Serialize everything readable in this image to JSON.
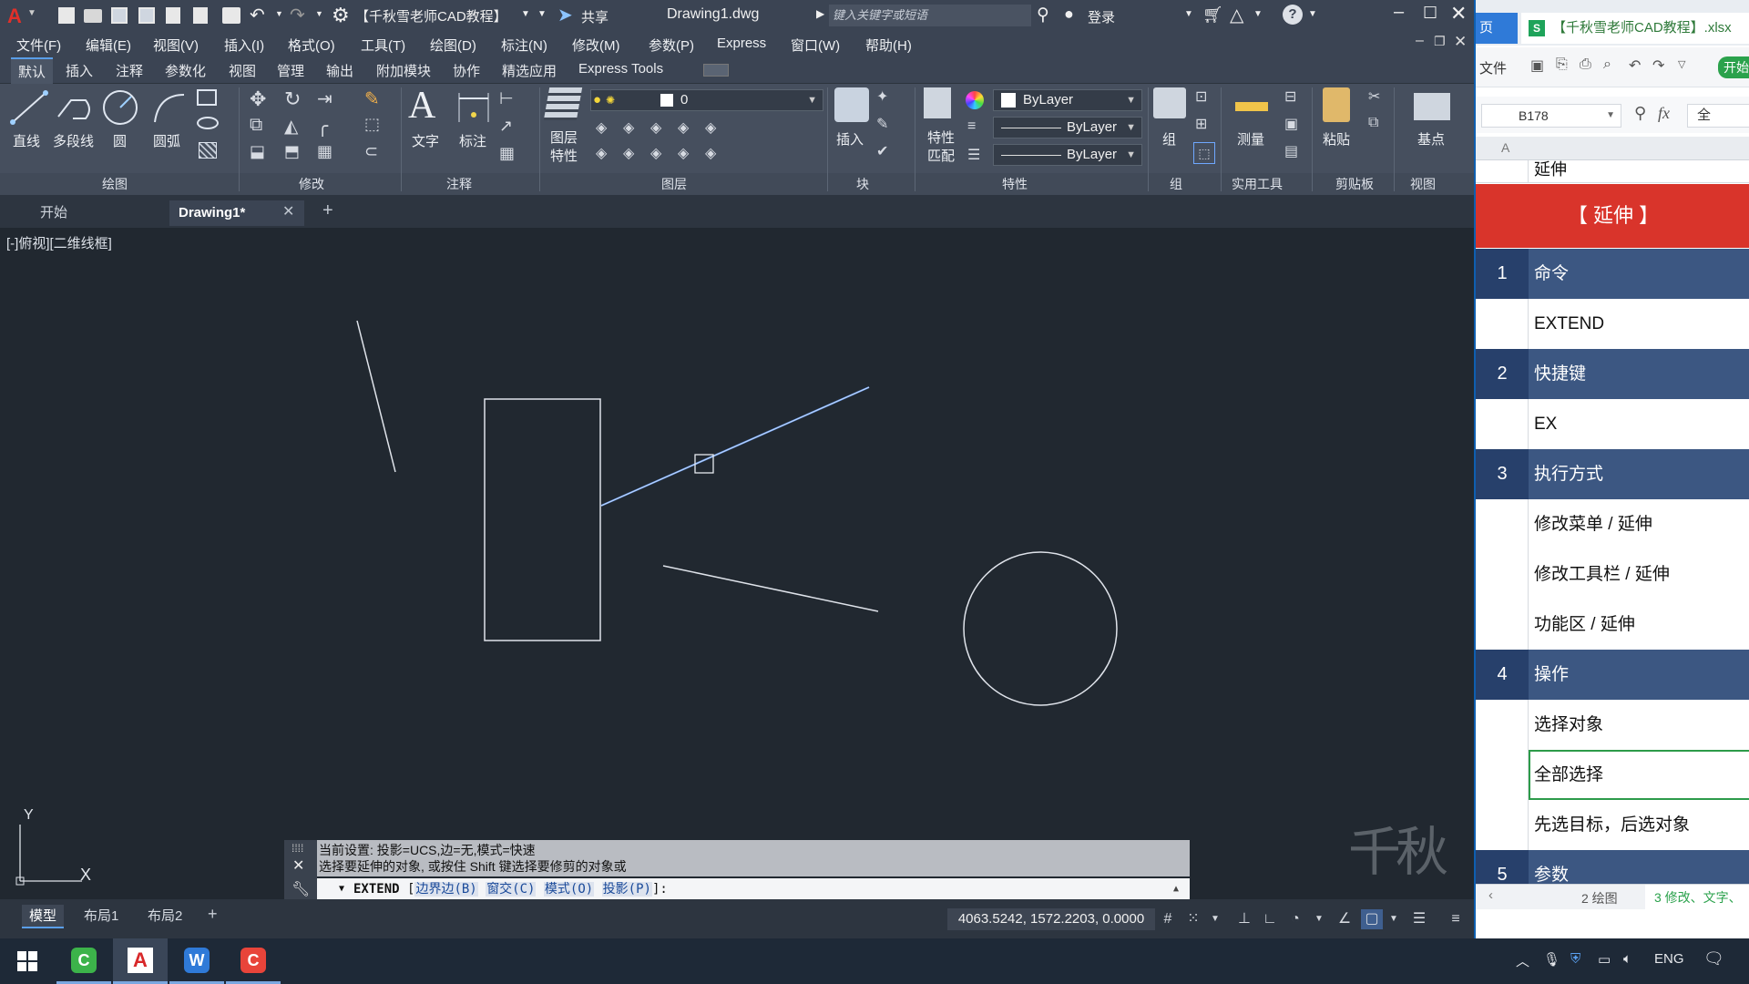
{
  "titlebar": {
    "workspace": "【千秋雪老师CAD教程】",
    "share": "共享",
    "filename": "Drawing1.dwg",
    "search_placeholder": "键入关键字或短语",
    "login": "登录"
  },
  "menu": [
    "文件(F)",
    "编辑(E)",
    "视图(V)",
    "插入(I)",
    "格式(O)",
    "工具(T)",
    "绘图(D)",
    "标注(N)",
    "修改(M)",
    "参数(P)",
    "Express",
    "窗口(W)",
    "帮助(H)"
  ],
  "ribbon_tabs": [
    "默认",
    "插入",
    "注释",
    "参数化",
    "视图",
    "管理",
    "输出",
    "附加模块",
    "协作",
    "精选应用",
    "Express Tools"
  ],
  "ribbon": {
    "draw": {
      "line": "直线",
      "polyline": "多段线",
      "circle": "圆",
      "arc": "圆弧"
    },
    "annotation": {
      "text": "文字",
      "dimension": "标注"
    },
    "layers": {
      "layer_props_1": "图层",
      "layer_props_2": "特性",
      "layer_name": "0"
    },
    "block": {
      "insert": "插入"
    },
    "properties": {
      "match_1": "特性",
      "match_2": "匹配",
      "color": "ByLayer",
      "linetype": "ByLayer",
      "lineweight": "ByLayer"
    },
    "groups": {
      "group": "组"
    },
    "utilities": {
      "measure": "测量"
    },
    "clipboard": {
      "paste": "粘贴"
    },
    "view": {
      "base": "基点"
    },
    "panel_labels": [
      "绘图",
      "修改",
      "注释",
      "图层",
      "块",
      "特性",
      "组",
      "实用工具",
      "剪贴板",
      "视图"
    ]
  },
  "doc_tabs": {
    "start": "开始",
    "drawing": "Drawing1*"
  },
  "viewport_label": "[-]俯视][二维线框]",
  "ucs": {
    "x": "X",
    "y": "Y"
  },
  "watermark": "千秋雪",
  "command": {
    "history_1": "当前设置: 投影=UCS,边=无,模式=快速",
    "history_2": "选择要延伸的对象, 或按住 Shift 键选择要修剪的对象或",
    "prompt": "EXTEND",
    "opt_1": "边界边(B)",
    "opt_2": "窗交(C)",
    "opt_3": "模式(O)",
    "opt_4": "投影(P)",
    "tail": "]:"
  },
  "layout_tabs": [
    "模型",
    "布局1",
    "布局2"
  ],
  "coordinates": "4063.5242, 1572.2203, 0.0000",
  "spreadsheet": {
    "home_tab": "页",
    "file_tab": "【千秋雪老师CAD教程】.xlsx",
    "file_menu": "文件",
    "start_btn": "开始",
    "namebox": "B178",
    "fx": "fx",
    "formula_value": "全",
    "col_a": "A",
    "top_cell": "延伸",
    "banner": "【 延伸 】",
    "rows": [
      {
        "num": "1",
        "text": "命令",
        "type": "section"
      },
      {
        "num": "",
        "text": "EXTEND",
        "type": "detail"
      },
      {
        "num": "2",
        "text": "快捷键",
        "type": "section"
      },
      {
        "num": "",
        "text": "EX",
        "type": "detail"
      },
      {
        "num": "3",
        "text": "执行方式",
        "type": "section"
      },
      {
        "num": "",
        "text": "修改菜单 / 延伸",
        "type": "detail"
      },
      {
        "num": "",
        "text": "修改工具栏 / 延伸",
        "type": "detail"
      },
      {
        "num": "",
        "text": "功能区 / 延伸",
        "type": "detail"
      },
      {
        "num": "4",
        "text": "操作",
        "type": "section"
      },
      {
        "num": "",
        "text": "选择对象",
        "type": "detail"
      },
      {
        "num": "",
        "text": "全部选择",
        "type": "detail",
        "selected": true
      },
      {
        "num": "",
        "text": "先选目标，后选对象",
        "type": "detail"
      },
      {
        "num": "5",
        "text": "参数",
        "type": "section"
      }
    ],
    "sheet_tabs": [
      "2 绘图",
      "3 修改、文字、"
    ]
  },
  "taskbar": {
    "lang": "ENG"
  },
  "colors": {
    "cad_bg": "#212830",
    "highlight_line": "#5b8fe0",
    "section_header": "#3c5782",
    "banner_red": "#d9342b"
  }
}
